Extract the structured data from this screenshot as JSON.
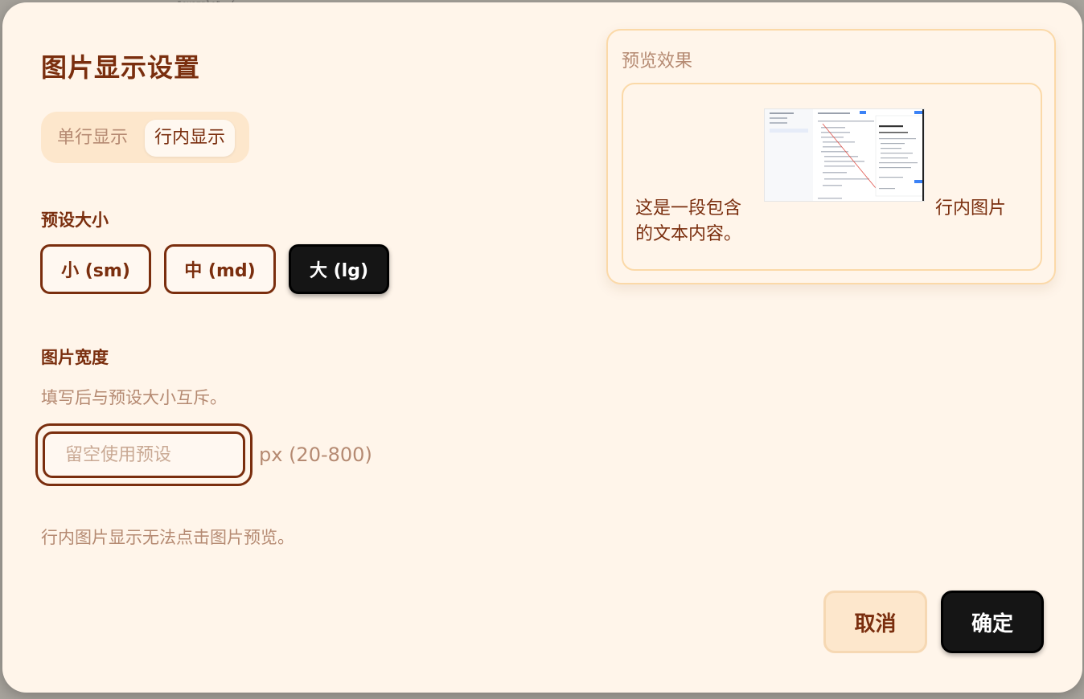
{
  "dialog": {
    "title": "图片显示设置",
    "display_mode": {
      "options": [
        "单行显示",
        "行内显示"
      ],
      "selected": "行内显示"
    },
    "preset_size": {
      "label": "预设大小",
      "options": [
        "小 (sm)",
        "中 (md)",
        "大 (lg)"
      ],
      "selected": "大 (lg)"
    },
    "image_width": {
      "label": "图片宽度",
      "hint": "填写后与预设大小互斥。",
      "placeholder": "留空使用预设",
      "value": "",
      "unit": "px (20-800)"
    },
    "note": "行内图片显示无法点击图片预览。",
    "preview": {
      "title": "预览效果",
      "text_before_line1": "这是一段包含",
      "text_after": "行内图片",
      "text_line2": "的文本内容。"
    },
    "buttons": {
      "cancel": "取消",
      "confirm": "确定"
    }
  },
  "colors": {
    "accent": "#7a2e0e",
    "muted": "#b58a72",
    "surface": "#fff5ea",
    "primary_button": "#151515",
    "preview_border": "#fbd9a8"
  },
  "icons": {
    "thumbnail": "inline-screenshot-thumbnail"
  }
}
